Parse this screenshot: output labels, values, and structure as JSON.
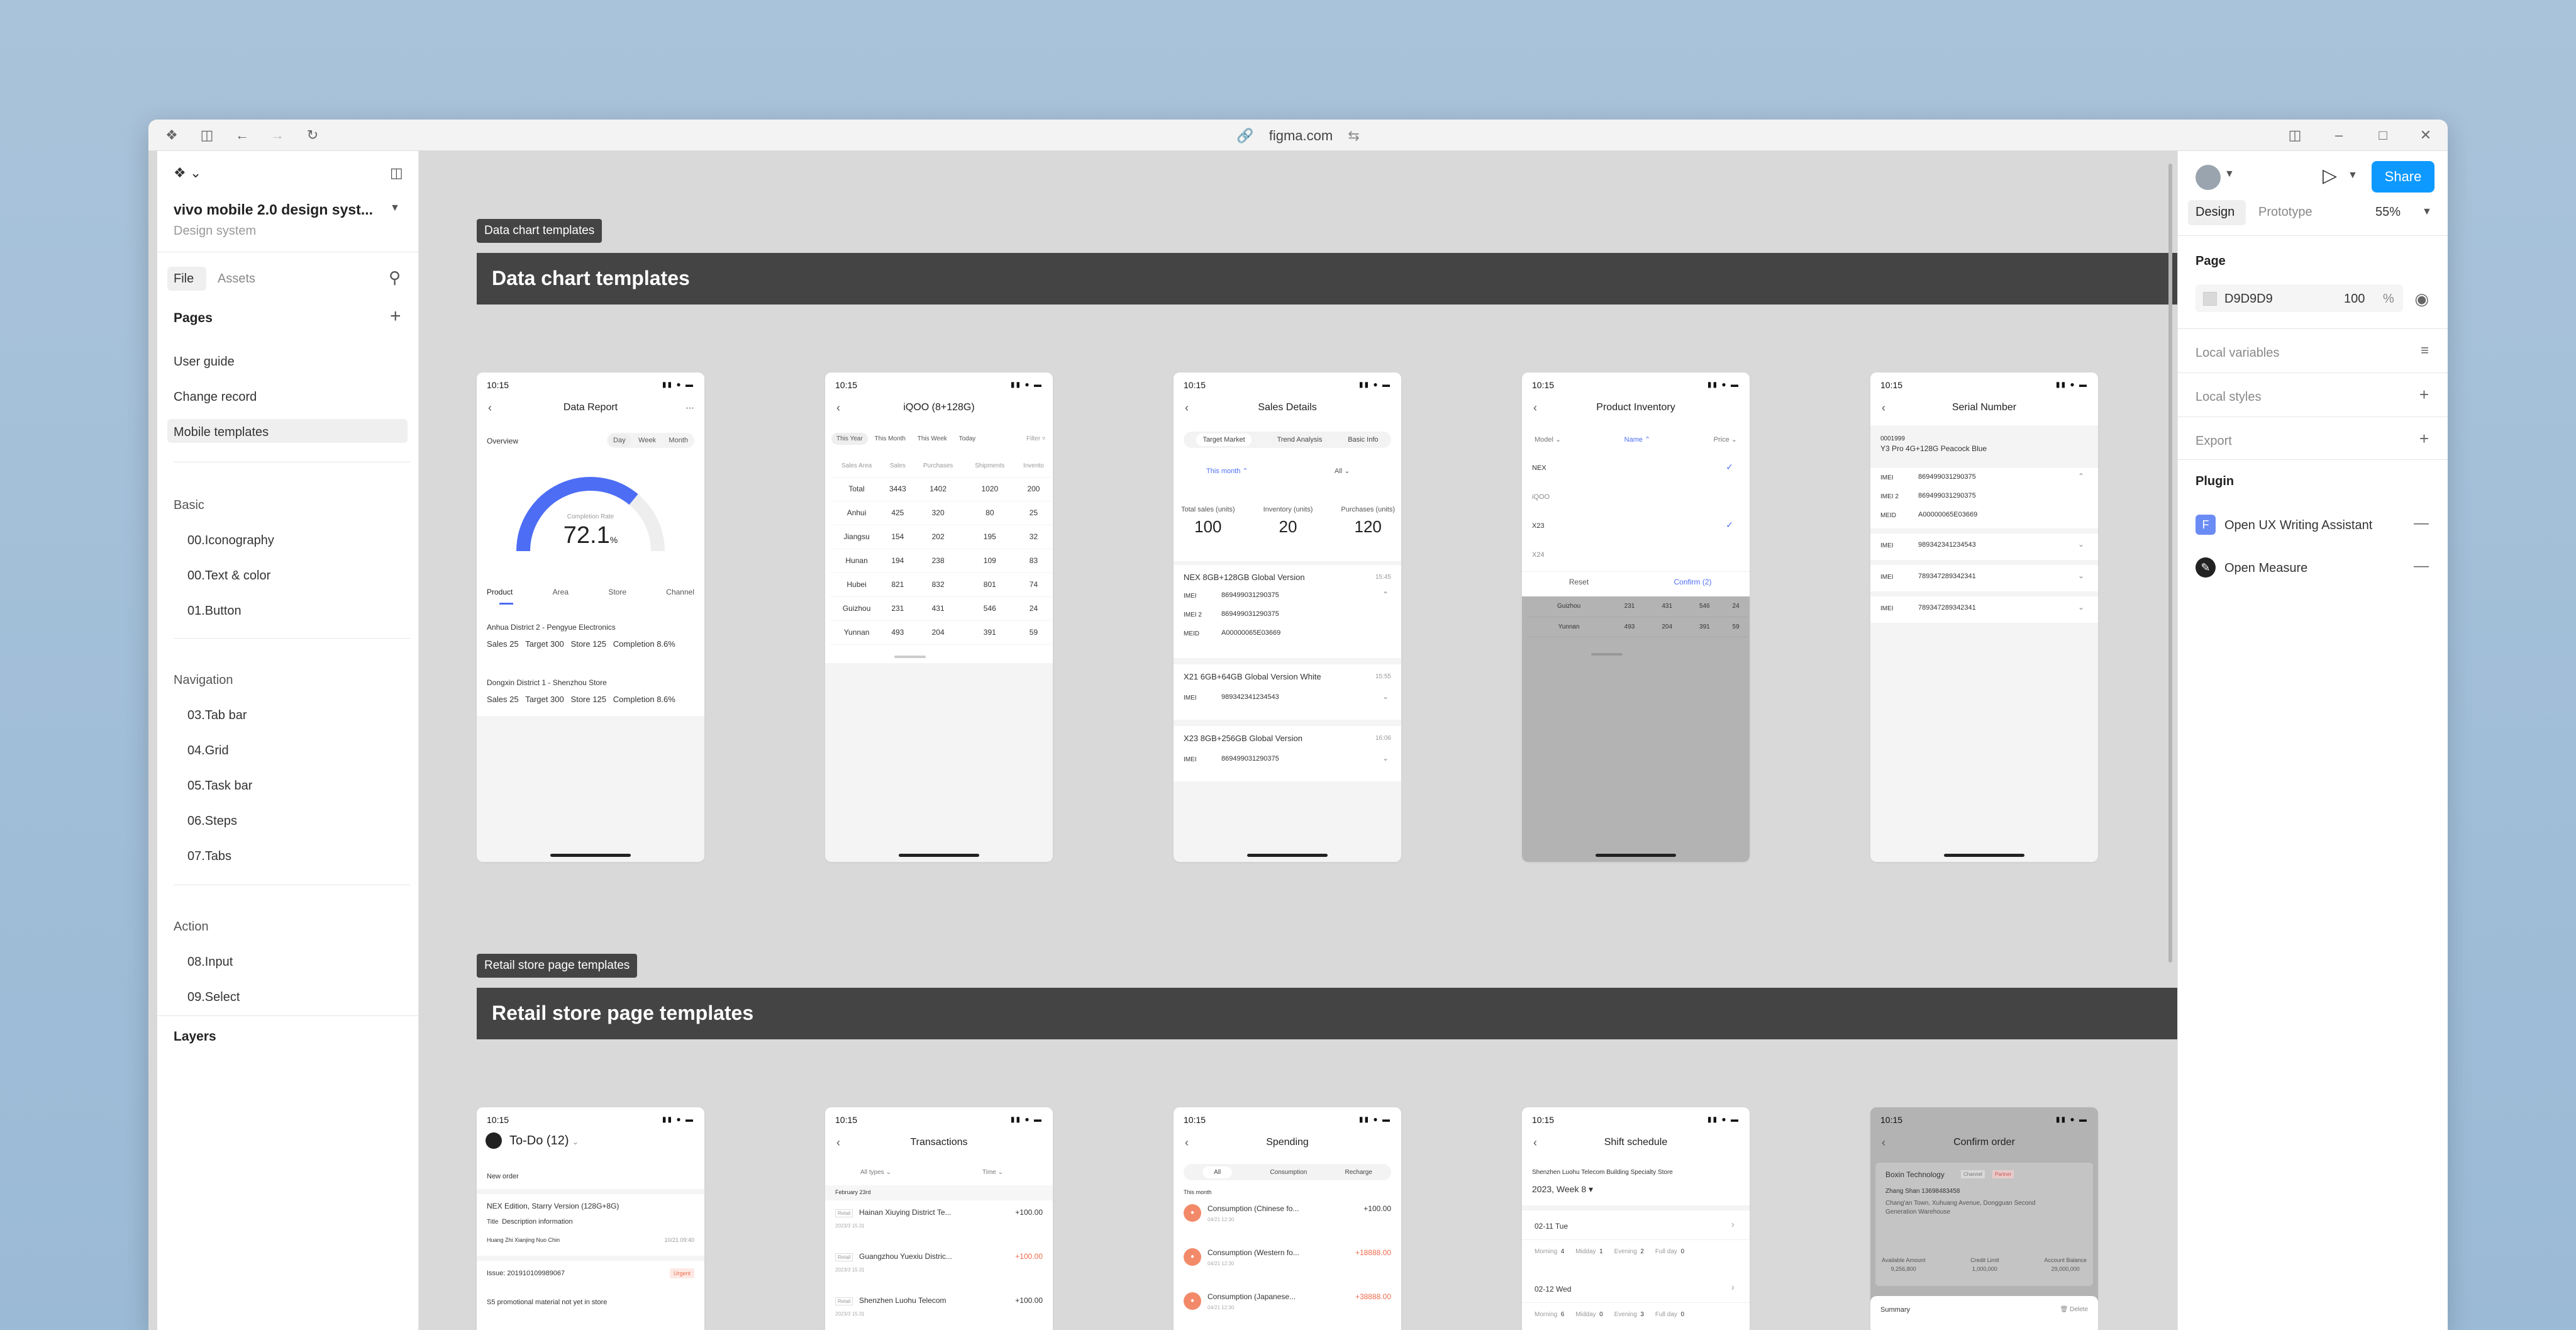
{
  "window": {
    "url": "figma.com"
  },
  "left_panel": {
    "file_title": "vivo mobile 2.0 design syst...",
    "file_subtitle": "Design system",
    "tabs": [
      "File",
      "Assets"
    ],
    "pages_heading": "Pages",
    "pages": [
      "User guide",
      "Change record",
      "Mobile templates"
    ],
    "sections": [
      {
        "title": "Basic",
        "items": [
          "00.Iconography",
          "00.Text & color",
          "01.Button"
        ]
      },
      {
        "title": "Navigation",
        "items": [
          "03.Tab bar",
          "04.Grid",
          "05.Task bar",
          "06.Steps",
          "07.Tabs"
        ]
      },
      {
        "title": "Action",
        "items": [
          "08.Input",
          "09.Select"
        ]
      }
    ],
    "layers_heading": "Layers"
  },
  "right_panel": {
    "share_label": "Share",
    "tabs": [
      "Design",
      "Prototype"
    ],
    "zoom": "55%",
    "page_heading": "Page",
    "page_color": "D9D9D9",
    "page_opacity": "100",
    "percent": "%",
    "local_variables": "Local variables",
    "local_styles": "Local styles",
    "export": "Export",
    "plugin_heading": "Plugin",
    "plugins": [
      "Open UX Writing Assistant",
      "Open Measure"
    ],
    "plugin_badge": "F"
  },
  "canvas": {
    "section1_tag": "Data chart templates",
    "section1_title": "Data chart templates",
    "section2_tag": "Retail store page templates",
    "section2_title": "Retail store page templates"
  },
  "phones": {
    "time": "10:15",
    "p1": {
      "title": "Data Report",
      "overview": "Overview",
      "ranges": [
        "Day",
        "Week",
        "Month"
      ],
      "gauge_label": "Completion Rate",
      "gauge_value": "72.1",
      "gauge_unit": "%",
      "tabs": [
        "Product",
        "Area",
        "Store",
        "Channel"
      ],
      "rows": [
        {
          "name": "Anhua District 2 - Pengyue Electronics",
          "sales": "25",
          "target": "300",
          "store": "125",
          "completion": "8.6%"
        },
        {
          "name": "Dongxin District 1 - Shenzhou Store",
          "sales": "25",
          "target": "300",
          "store": "125",
          "completion": "8.6%"
        }
      ],
      "labels": [
        "Sales",
        "Target",
        "Store",
        "Completion"
      ]
    },
    "p2": {
      "title": "iQOO (8+128G)",
      "ranges": [
        "This Year",
        "This Month",
        "This Week",
        "Today"
      ],
      "filter": "Filter",
      "headers": [
        "Sales Area",
        "Sales",
        "Purchases",
        "Shipments",
        "Invento"
      ],
      "rows": [
        [
          "Total",
          "3443",
          "1402",
          "1020",
          "200"
        ],
        [
          "Anhui",
          "425",
          "320",
          "80",
          "25"
        ],
        [
          "Jiangsu",
          "154",
          "202",
          "195",
          "32"
        ],
        [
          "Hunan",
          "194",
          "238",
          "109",
          "83"
        ],
        [
          "Hubei",
          "821",
          "832",
          "801",
          "74"
        ],
        [
          "Guizhou",
          "231",
          "431",
          "546",
          "24"
        ],
        [
          "Yunnan",
          "493",
          "204",
          "391",
          "59"
        ]
      ]
    },
    "p3": {
      "title": "Sales Details",
      "tabs": [
        "Target Market",
        "Trend Analysis",
        "Basic Info"
      ],
      "filter_a": "This month",
      "filter_b": "All",
      "stats": [
        {
          "label": "Total sales (units)",
          "value": "100"
        },
        {
          "label": "Inventory (units)",
          "value": "20"
        },
        {
          "label": "Purchases (units)",
          "value": "120"
        }
      ],
      "items": [
        {
          "name": "NEX 8GB+128GB Global Version",
          "time": "15:45",
          "imeis": [
            "869499031290375",
            "869499031290375",
            "A00000065E03669"
          ],
          "labels": [
            "IMEI",
            "IMEI 2",
            "MEID"
          ]
        },
        {
          "name": "X21 6GB+64GB Global Version White",
          "time": "15:55",
          "imeis": [
            "989342341234543"
          ],
          "labels": [
            "IMEI"
          ]
        },
        {
          "name": "X23 8GB+256GB Global Version",
          "time": "16:06",
          "imeis": [
            "869499031290375"
          ],
          "labels": [
            "IMEI"
          ]
        }
      ]
    },
    "p4": {
      "title": "Product Inventory",
      "filters": [
        "Model",
        "Name",
        "Price"
      ],
      "options": [
        "NEX",
        "iQOO",
        "X23",
        "X24"
      ],
      "reset": "Reset",
      "confirm": "Confirm (2)",
      "rows": [
        [
          "Guizhou",
          "231",
          "431",
          "546",
          "24"
        ],
        [
          "Yunnan",
          "493",
          "204",
          "391",
          "59"
        ]
      ]
    },
    "p5": {
      "title": "Serial Number",
      "sub": "0001999",
      "model": "Y3 Pro 4G+128G Peacock Blue",
      "groups": [
        {
          "labels": [
            "IMEI",
            "IMEI 2",
            "MEID"
          ],
          "values": [
            "869499031290375",
            "869499031290375",
            "A00000065E03669"
          ]
        },
        {
          "labels": [
            "IMEI"
          ],
          "values": [
            "989342341234543"
          ]
        },
        {
          "labels": [
            "IMEI"
          ],
          "values": [
            "789347289342341"
          ]
        },
        {
          "labels": [
            "IMEI"
          ],
          "values": [
            "789347289342341"
          ]
        }
      ]
    },
    "r1": {
      "title": "To-Do (12)",
      "section": "New order",
      "item1": "NEX Edition, Starry Version (128G+8G)",
      "item1_label": "Title",
      "item1_desc": "Description information",
      "item1_meta": "Huang Zhi Xianjing Nuo Chin",
      "item1_time": "10/21 09:40",
      "issue": "Issue: 201910109989067",
      "issue_badge": "Urgent",
      "issue_desc": "S5 promotional material not yet in store"
    },
    "r2": {
      "title": "Transactions",
      "filters": [
        "All types",
        "Time"
      ],
      "date": "February 23rd",
      "items": [
        {
          "name": "Hainan Xiuying District Te...",
          "amount": "+100.00",
          "tag": "Retail",
          "time": "2023/3 15:31",
          "red": false
        },
        {
          "name": "Guangzhou Yuexiu Distric...",
          "amount": "+100.00",
          "tag": "Retail",
          "time": "2023/3 15:31",
          "red": true
        },
        {
          "name": "Shenzhen Luohu Telecom",
          "amount": "+100.00",
          "tag": "Retail",
          "time": "2023/3 15:31",
          "red": false
        }
      ]
    },
    "r3": {
      "title": "Spending",
      "tabs": [
        "All",
        "Consumption",
        "Recharge"
      ],
      "month": "This month",
      "items": [
        {
          "name": "Consumption (Chinese fo...",
          "amount": "+100.00",
          "time": "04/21 12:30",
          "red": false
        },
        {
          "name": "Consumption (Western fo...",
          "amount": "+18888.00",
          "time": "04/21 12:30",
          "red": true
        },
        {
          "name": "Consumption (Japanese...",
          "amount": "+38888.00",
          "time": "04/21 12:30",
          "red": true
        }
      ]
    },
    "r4": {
      "title": "Shift schedule",
      "store": "Shenzhen Luohu Telecom Building Specialty Store",
      "week": "2023, Week 8",
      "days": [
        {
          "date": "02-11 Tue",
          "counts": [
            "Morning",
            "4",
            "Midday",
            "1",
            "Evening",
            "2",
            "Full day",
            "0"
          ]
        },
        {
          "date": "02-12 Wed",
          "counts": [
            "Morning",
            "6",
            "Midday",
            "0",
            "Evening",
            "3",
            "Full day",
            "0"
          ]
        }
      ]
    },
    "r5": {
      "title": "Confirm order",
      "company": "Boxin Technology",
      "badges": [
        "Channel",
        "Partner"
      ],
      "contact": "Zhang Shan 13698483458",
      "address": "Chang'an Town, Xuhuang Avenue, Dongguan Second Generation Warehouse",
      "stats": [
        {
          "label": "Available Amount",
          "value": "9,256,800"
        },
        {
          "label": "Credit Limit",
          "value": "1,000,000"
        },
        {
          "label": "Account Balance",
          "value": "29,000,000"
        }
      ],
      "summary": "Summary",
      "delete": "Delete"
    }
  }
}
